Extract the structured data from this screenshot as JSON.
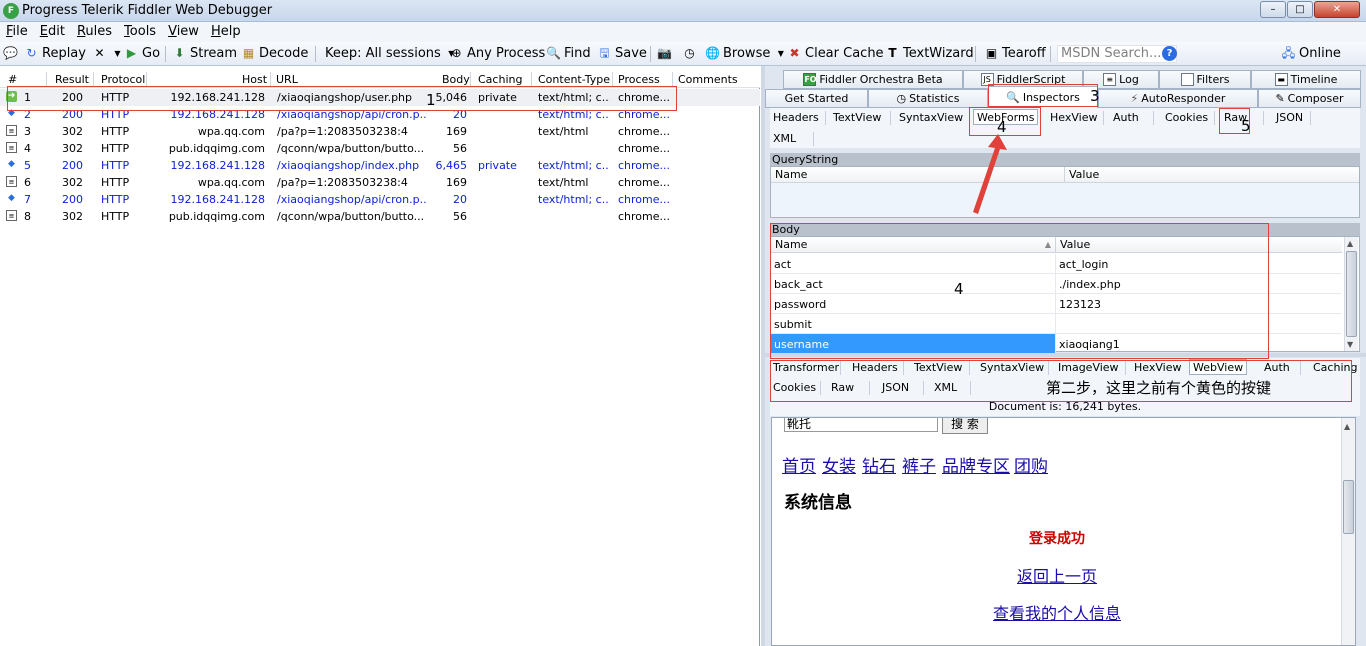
{
  "window": {
    "title": "Progress Telerik Fiddler Web Debugger",
    "icon_letter": "F",
    "controls": [
      "–",
      "□",
      "✕"
    ]
  },
  "menu": [
    {
      "key": "F",
      "rest": "ile"
    },
    {
      "key": "E",
      "rest": "dit"
    },
    {
      "key": "R",
      "rest": "ules"
    },
    {
      "key": "T",
      "rest": "ools"
    },
    {
      "key": "V",
      "rest": "iew"
    },
    {
      "key": "H",
      "rest": "elp"
    }
  ],
  "toolbar": {
    "replay": "Replay",
    "go": "Go",
    "stream": "Stream",
    "decode": "Decode",
    "keep": "Keep: All sessions",
    "process": "Any Process",
    "find": "Find",
    "save": "Save",
    "browse": "Browse",
    "clear_cache": "Clear Cache",
    "textwizard": "TextWizard",
    "tearoff": "Tearoff",
    "msdn_placeholder": "MSDN Search...",
    "online": "Online"
  },
  "sessions": {
    "headers": [
      "#",
      "Result",
      "Protocol",
      "Host",
      "URL",
      "Body",
      "Caching",
      "Content-Type",
      "Process",
      "Comments"
    ],
    "rows": [
      {
        "num": "1",
        "result": "200",
        "protocol": "HTTP",
        "host": "192.168.241.128",
        "url": "/xiaoqiangshop/user.php",
        "body": "5,046",
        "caching": "private",
        "ctype": "text/html; c...",
        "process": "chrome...",
        "icon": "play",
        "style": "selected"
      },
      {
        "num": "2",
        "result": "200",
        "protocol": "HTTP",
        "host": "192.168.241.128",
        "url": "/xiaoqiangshop/api/cron.p...",
        "body": "20",
        "caching": "",
        "ctype": "text/html; c...",
        "process": "chrome...",
        "icon": "arrows",
        "style": "blue"
      },
      {
        "num": "3",
        "result": "302",
        "protocol": "HTTP",
        "host": "wpa.qq.com",
        "url": "/pa?p=1:2083503238:4",
        "body": "169",
        "caching": "",
        "ctype": "text/html",
        "process": "chrome...",
        "icon": "doc",
        "style": "normal"
      },
      {
        "num": "4",
        "result": "302",
        "protocol": "HTTP",
        "host": "pub.idqqimg.com",
        "url": "/qconn/wpa/button/butto...",
        "body": "56",
        "caching": "",
        "ctype": "",
        "process": "chrome...",
        "icon": "doc",
        "style": "normal"
      },
      {
        "num": "5",
        "result": "200",
        "protocol": "HTTP",
        "host": "192.168.241.128",
        "url": "/xiaoqiangshop/index.php",
        "body": "6,465",
        "caching": "private",
        "ctype": "text/html; c...",
        "process": "chrome...",
        "icon": "arrows",
        "style": "blue"
      },
      {
        "num": "6",
        "result": "302",
        "protocol": "HTTP",
        "host": "wpa.qq.com",
        "url": "/pa?p=1:2083503238:4",
        "body": "169",
        "caching": "",
        "ctype": "text/html",
        "process": "chrome...",
        "icon": "doc",
        "style": "normal"
      },
      {
        "num": "7",
        "result": "200",
        "protocol": "HTTP",
        "host": "192.168.241.128",
        "url": "/xiaoqiangshop/api/cron.p...",
        "body": "20",
        "caching": "",
        "ctype": "text/html; c...",
        "process": "chrome...",
        "icon": "arrows",
        "style": "blue"
      },
      {
        "num": "8",
        "result": "302",
        "protocol": "HTTP",
        "host": "pub.idqqimg.com",
        "url": "/qconn/wpa/button/butto...",
        "body": "56",
        "caching": "",
        "ctype": "",
        "process": "chrome...",
        "icon": "doc",
        "style": "normal"
      }
    ]
  },
  "right_tabs": {
    "row1": [
      "Fiddler Orchestra Beta",
      "FiddlerScript",
      "Log",
      "Filters",
      "Timeline"
    ],
    "row2": [
      "Get Started",
      "Statistics",
      "Inspectors",
      "AutoResponder",
      "Composer"
    ],
    "active": "Inspectors"
  },
  "request_tabs": [
    "Headers",
    "TextView",
    "SyntaxView",
    "WebForms",
    "HexView",
    "Auth",
    "Cookies",
    "Raw",
    "JSON",
    "XML"
  ],
  "request_active": "WebForms",
  "querystring": {
    "title": "QueryString",
    "col_name": "Name",
    "col_value": "Value"
  },
  "body": {
    "title": "Body",
    "col_name": "Name",
    "col_value": "Value",
    "rows": [
      {
        "name": "act",
        "value": "act_login"
      },
      {
        "name": "back_act",
        "value": "./index.php"
      },
      {
        "name": "password",
        "value": "123123"
      },
      {
        "name": "submit",
        "value": ""
      },
      {
        "name": "username",
        "value": "xiaoqiang1"
      }
    ],
    "selected_index": 4
  },
  "response_tabs": [
    "Transformer",
    "Headers",
    "TextView",
    "SyntaxView",
    "ImageView",
    "HexView",
    "WebView",
    "Auth",
    "Caching",
    "Cookies",
    "Raw",
    "JSON",
    "XML"
  ],
  "response_active": "WebView",
  "doc_info": "Document is: 16,241 bytes.",
  "webview": {
    "search_value": "靴托",
    "search_button": "搜 索",
    "nav": [
      "首页",
      "女装",
      "钻石",
      "裤子",
      "品牌专区",
      "团购"
    ],
    "heading": "系统信息",
    "success": "登录成功",
    "back_link": "返回上一页",
    "profile_link": "查看我的个人信息"
  },
  "annotations": {
    "n1": "1",
    "n3": "3",
    "n4a": "4",
    "n4b": "4",
    "n5": "5",
    "note": "第二步，这里之前有个黄色的按键",
    "color": "#e0413a"
  }
}
